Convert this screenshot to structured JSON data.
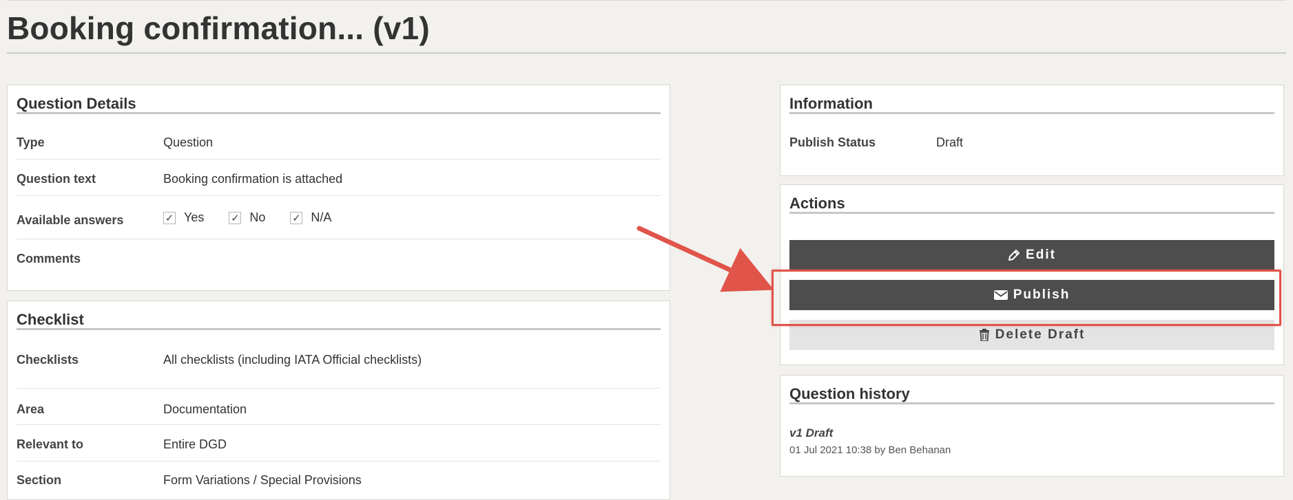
{
  "page": {
    "title": "Booking confirmation... (v1)"
  },
  "question_details": {
    "heading": "Question Details",
    "rows": [
      {
        "label": "Type",
        "value": "Question"
      },
      {
        "label": "Question text",
        "value": "Booking confirmation is attached"
      },
      {
        "label": "Available answers",
        "value": ""
      },
      {
        "label": "Comments",
        "value": ""
      }
    ],
    "answers": [
      {
        "label": "Yes",
        "checked": true
      },
      {
        "label": "No",
        "checked": true
      },
      {
        "label": "N/A",
        "checked": true
      }
    ]
  },
  "checklist": {
    "heading": "Checklist",
    "rows": [
      {
        "label": "Checklists",
        "value": "All checklists (including IATA Official checklists)"
      },
      {
        "label": "Area",
        "value": "Documentation"
      },
      {
        "label": "Relevant to",
        "value": "Entire DGD"
      },
      {
        "label": "Section",
        "value": "Form Variations / Special Provisions"
      }
    ]
  },
  "information": {
    "heading": "Information",
    "publish_status_label": "Publish Status",
    "publish_status_value": "Draft"
  },
  "actions": {
    "heading": "Actions",
    "edit_label": "Edit",
    "publish_label": "Publish",
    "delete_label": "Delete Draft"
  },
  "history": {
    "heading": "Question history",
    "entries": [
      {
        "version": "v1 Draft",
        "meta": "01 Jul 2021 10:38 by Ben Behanan"
      }
    ]
  },
  "colors": {
    "background": "#f2f1ee",
    "dark_button": "#4d4d4d",
    "light_button": "#e4e4e4",
    "annotation": "#e0544a"
  },
  "icons": [
    "pencil-icon",
    "envelope-icon",
    "trash-icon",
    "check-icon"
  ]
}
